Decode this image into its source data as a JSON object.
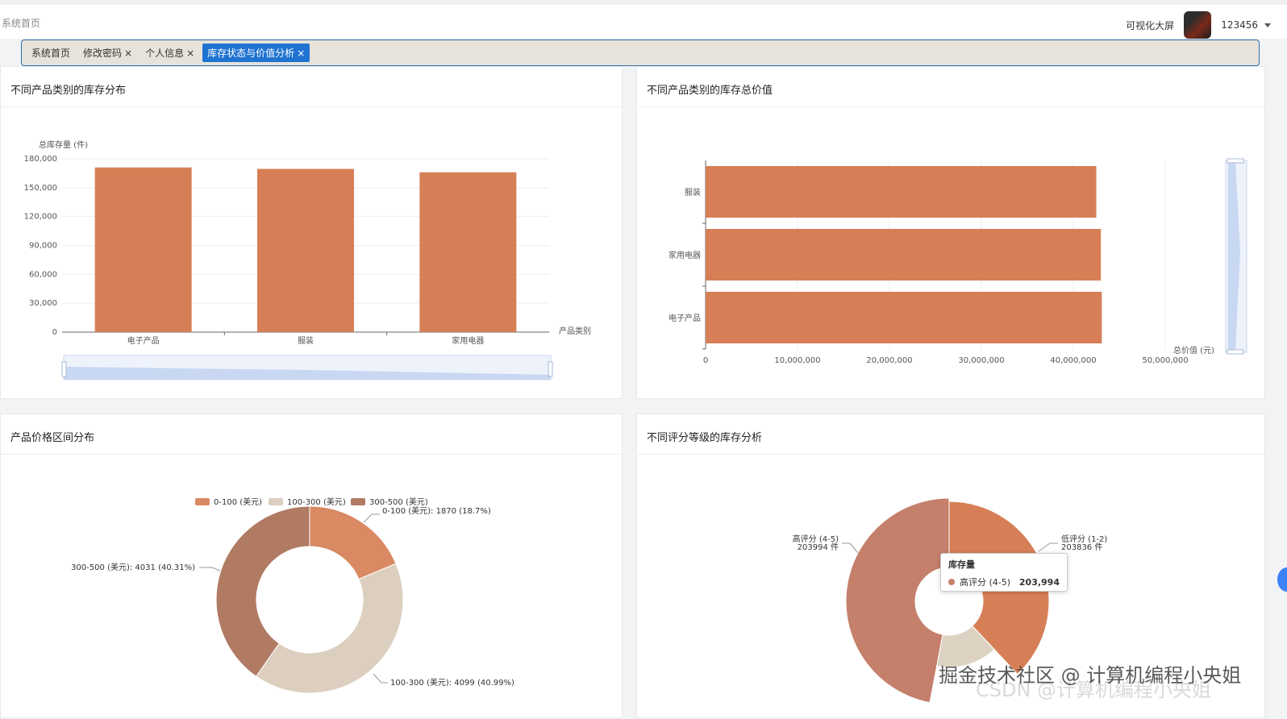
{
  "header": {
    "crumb": "系统首页",
    "screen_link": "可视化大屏",
    "username": "123456"
  },
  "tabs": [
    {
      "label": "系统首页",
      "closable": false,
      "active": false
    },
    {
      "label": "修改密码",
      "closable": true,
      "active": false
    },
    {
      "label": "个人信息",
      "closable": true,
      "active": false
    },
    {
      "label": "库存状态与价值分析",
      "closable": true,
      "active": true
    }
  ],
  "close_glyph": "×",
  "cards": {
    "c1_title": "不同产品类别的库存分布",
    "c2_title": "不同产品类别的库存总价值",
    "c3_title": "产品价格区间分布",
    "c4_title": "不同评分等级的库存分析"
  },
  "tooltip": {
    "title": "库存量",
    "label": "高评分 (4-5)",
    "value": "203,994"
  },
  "watermark": {
    "line1": "掘金技术社区 @ 计算机编程小央姐",
    "line2": "CSDN @计算机编程小央姐"
  },
  "colors": {
    "bar": "#d67f56",
    "slider": "#c8d7f2",
    "pie1": "#d98a63",
    "pie2": "#dccfbf",
    "pie3": "#b07a63",
    "rose_high": "#c5806b",
    "rose_low": "#d67f56",
    "rose_mid": "#ded3c3"
  },
  "chart_data": [
    {
      "type": "bar",
      "title": "不同产品类别的库存分布",
      "ylabel": "总库存量 (件)",
      "xlabel": "产品类别",
      "categories": [
        "电子产品",
        "服装",
        "家用电器"
      ],
      "values": [
        171000,
        169500,
        166000
      ],
      "ylim": [
        0,
        180000
      ],
      "yticks": [
        "0",
        "30,000",
        "60,000",
        "90,000",
        "120,000",
        "150,000",
        "180,000"
      ],
      "dataZoom": true
    },
    {
      "type": "bar",
      "orientation": "horizontal",
      "title": "不同产品类别的库存总价值",
      "xlabel": "总价值 (元)",
      "categories": [
        "电子产品",
        "家用电器",
        "服装"
      ],
      "values": [
        43100000,
        43000000,
        42500000
      ],
      "xlim": [
        0,
        50000000
      ],
      "xticks": [
        "0",
        "10,000,000",
        "20,000,000",
        "30,000,000",
        "40,000,000",
        "50,000,000"
      ],
      "dataZoom": true
    },
    {
      "type": "pie",
      "donut": true,
      "title": "产品价格区间分布",
      "legend": [
        "0-100 (美元)",
        "100-300 (美元)",
        "300-500 (美元)"
      ],
      "values": [
        1870,
        4099,
        4031
      ],
      "labels": [
        "0-100 (美元): 1870 (18.7%)",
        "100-300 (美元): 4099 (40.99%)",
        "300-500 (美元): 4031 (40.31%)"
      ]
    },
    {
      "type": "pie",
      "rose": true,
      "title": "不同评分等级的库存分析",
      "series_name": "库存量",
      "labels": [
        "高评分 (4-5)",
        "低评分 (1-2)"
      ],
      "values_text": [
        "203994 件",
        "203836 件"
      ],
      "values": [
        203994,
        203836
      ]
    }
  ]
}
